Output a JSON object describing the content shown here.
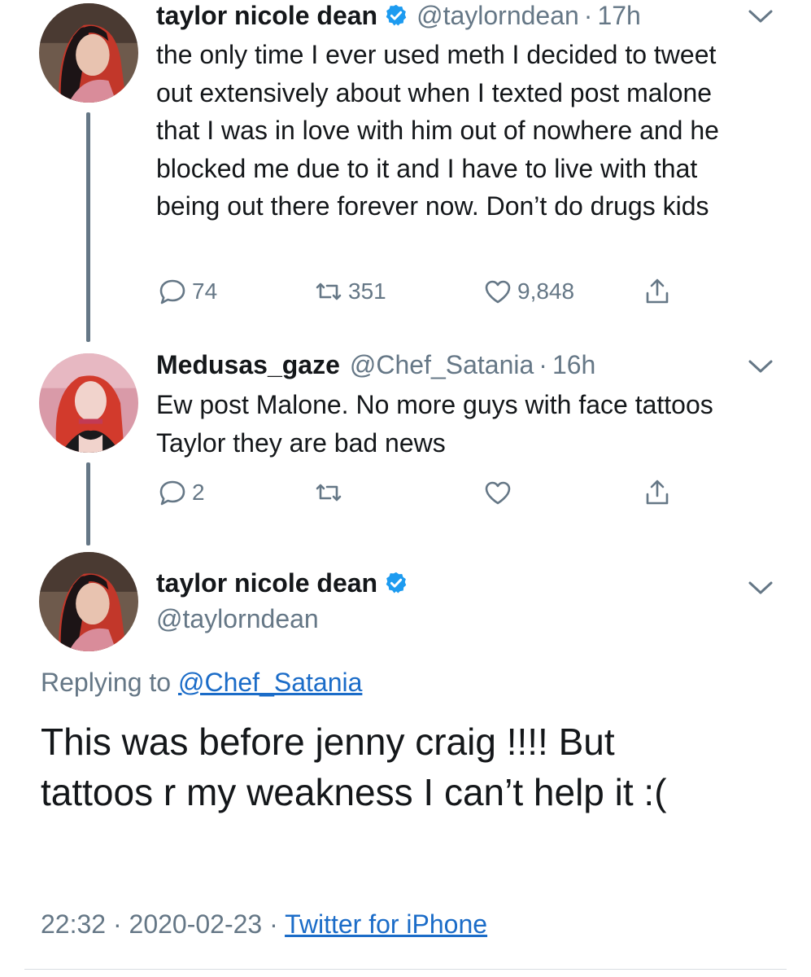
{
  "tweets": [
    {
      "name": "taylor nicole dean",
      "handle": "@taylorndean",
      "dot": "·",
      "time": "17h",
      "text": "the only time I ever used meth I decided to tweet out extensively about when I texted post malone that I was in love with him out of nowhere and he blocked me due to it and I have to live with that being out there forever now. Don’t do drugs kids",
      "replies": "74",
      "retweets": "351",
      "likes": "9,848",
      "verified": true
    },
    {
      "name": "Medusas_gaze",
      "handle": "@Chef_Satania",
      "dot": "·",
      "time": "16h",
      "text": "Ew post Malone. No more guys with face tattoos Taylor they are bad news",
      "replies": "2",
      "retweets": "",
      "likes": "",
      "verified": false
    }
  ],
  "main_tweet": {
    "name": "taylor nicole dean",
    "handle": "@taylorndean",
    "replying_prefix": "Replying to ",
    "replying_handle": "@Chef_Satania",
    "text": "This was before jenny craig !!!! But tattoos r my weakness I can’t help it :(",
    "time": "22:32",
    "sep1": " · ",
    "date": "2020-02-23",
    "sep2": " · ",
    "source": "Twitter for iPhone"
  },
  "icons": {
    "reply": "reply-icon",
    "retweet": "retweet-icon",
    "like": "like-icon",
    "share": "share-icon",
    "verified": "verified-badge-icon",
    "caret": "chevron-down-icon"
  },
  "colors": {
    "text": "#14171a",
    "secondary": "#657786",
    "link": "#1b6cc8",
    "verified": "#1d9bf0",
    "thread_line": "#657786"
  }
}
